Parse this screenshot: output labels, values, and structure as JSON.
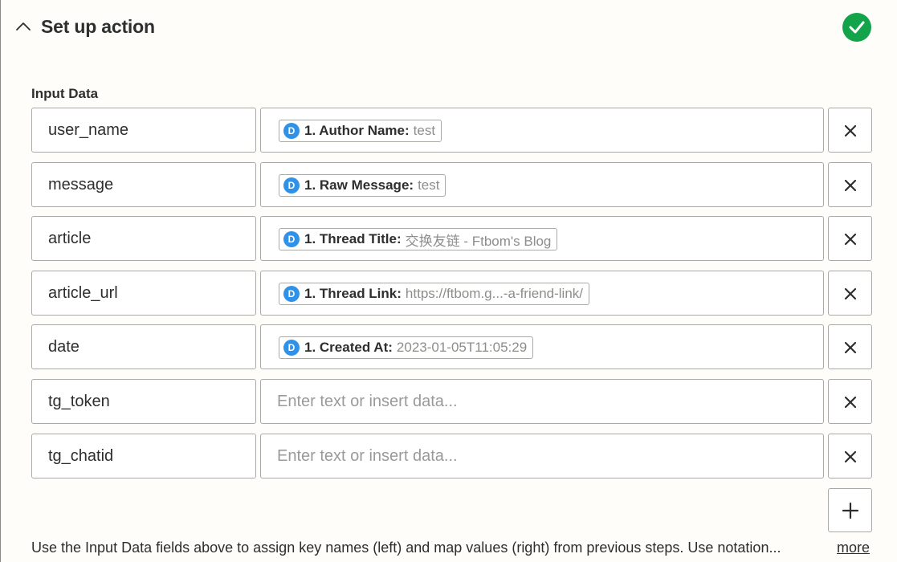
{
  "header": {
    "title": "Set up action",
    "status_icon": "check-circle-icon",
    "accent_color": "#13a34a"
  },
  "input_data": {
    "label": "Input Data",
    "placeholder": "Enter text or insert data...",
    "rows": [
      {
        "key": "user_name",
        "mapped": {
          "app_icon": "D",
          "label": "1. Author Name:",
          "value": "test"
        }
      },
      {
        "key": "message",
        "mapped": {
          "app_icon": "D",
          "label": "1. Raw Message:",
          "value": "test"
        }
      },
      {
        "key": "article",
        "mapped": {
          "app_icon": "D",
          "label": "1. Thread Title:",
          "value": "交换友链 - Ftbom's Blog"
        }
      },
      {
        "key": "article_url",
        "mapped": {
          "app_icon": "D",
          "label": "1. Thread Link:",
          "value": "https://ftbom.g...-a-friend-link/"
        }
      },
      {
        "key": "date",
        "mapped": {
          "app_icon": "D",
          "label": "1. Created At:",
          "value": "2023-01-05T11:05:29"
        }
      },
      {
        "key": "tg_token",
        "mapped": null
      },
      {
        "key": "tg_chatid",
        "mapped": null
      }
    ]
  },
  "footer": {
    "help_text": "Use the Input Data fields above to assign key names (left) and map values (right) from previous steps. Use notation...",
    "more_label": "more"
  },
  "icons": {
    "collapse": "chevron-up-icon",
    "remove": "close-icon",
    "add": "plus-icon",
    "app": "disqus-app-icon"
  },
  "colors": {
    "app_icon": "#2f92e8",
    "border": "#a9a9a6",
    "placeholder": "#9a9a98"
  }
}
